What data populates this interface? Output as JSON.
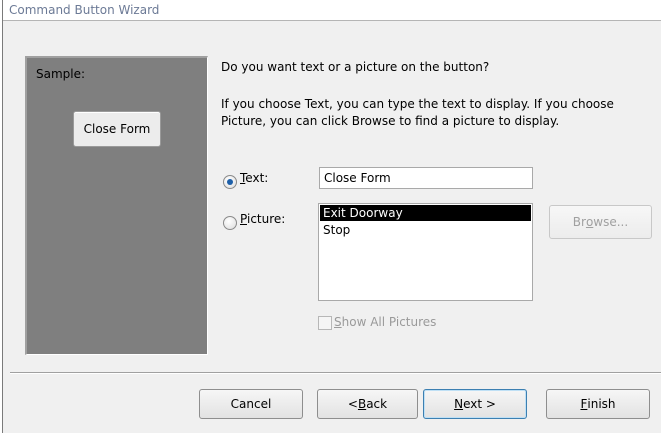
{
  "window": {
    "title": "Command Button Wizard"
  },
  "sample": {
    "label": "Sample:",
    "button_text": "Close Form"
  },
  "prompt": {
    "question": "Do you want text or a picture on the button?",
    "description": "If you choose Text, you can type the text to display.  If you choose Picture, you can click Browse to find a picture to display."
  },
  "options": {
    "text": {
      "label_pre": "",
      "label_acc": "T",
      "label_post": "ext:",
      "selected": true,
      "value": "Close Form"
    },
    "picture": {
      "label_pre": "",
      "label_acc": "P",
      "label_post": "icture:",
      "selected": false,
      "items": [
        "Exit Doorway",
        "Stop"
      ],
      "selected_item": "Exit Doorway"
    }
  },
  "browse": {
    "label_pre": "Br",
    "label_acc": "o",
    "label_post": "wse..."
  },
  "show_all": {
    "label_pre": "",
    "label_acc": "S",
    "label_post": "how All Pictures"
  },
  "footer": {
    "cancel": "Cancel",
    "back_pre": "< ",
    "back_acc": "B",
    "back_post": "ack",
    "next_pre": "",
    "next_acc": "N",
    "next_post": "ext >",
    "finish_pre": "",
    "finish_acc": "F",
    "finish_post": "inish"
  }
}
